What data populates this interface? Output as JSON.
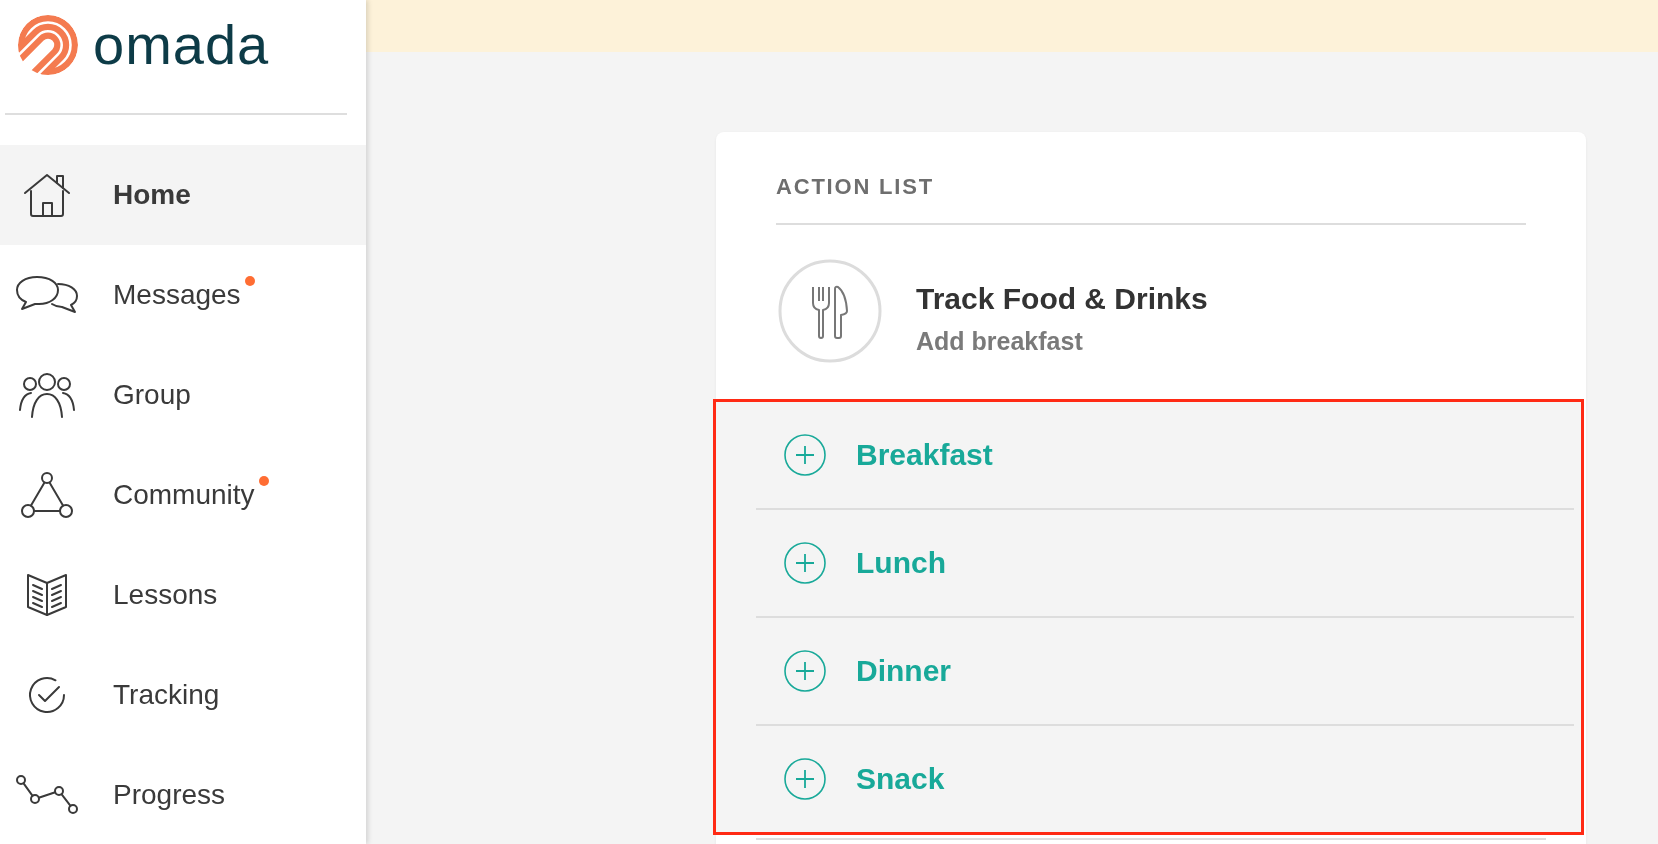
{
  "logo": {
    "wordmark": "omada"
  },
  "sidebar": {
    "items": [
      {
        "label": "Home",
        "selected": true,
        "notification": false
      },
      {
        "label": "Messages",
        "selected": false,
        "notification": true
      },
      {
        "label": "Group",
        "selected": false,
        "notification": false
      },
      {
        "label": "Community",
        "selected": false,
        "notification": true
      },
      {
        "label": "Lessons",
        "selected": false,
        "notification": false
      },
      {
        "label": "Tracking",
        "selected": false,
        "notification": false
      },
      {
        "label": "Progress",
        "selected": false,
        "notification": false
      }
    ]
  },
  "action_list": {
    "title": "ACTION LIST",
    "task": {
      "title": "Track Food & Drinks",
      "subtitle": "Add breakfast"
    },
    "meal_panel": {
      "highlighted": true,
      "items": [
        {
          "label": "Breakfast"
        },
        {
          "label": "Lunch"
        },
        {
          "label": "Dinner"
        },
        {
          "label": "Snack"
        }
      ]
    }
  }
}
